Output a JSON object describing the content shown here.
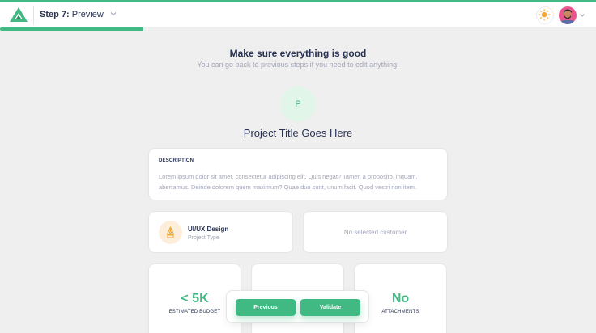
{
  "header": {
    "step_bold": "Step 7:",
    "step_light": "Preview",
    "progress_fraction": 0.24
  },
  "colors": {
    "accent": "#41b983",
    "text_dark": "#283252",
    "text_muted": "#a2a5b9",
    "background": "#efefef"
  },
  "icons": {
    "logo": "logo-triangle-icon",
    "step_menu": "chevron-down-icon",
    "theme": "sun-icon",
    "user": "user-avatar",
    "user_menu": "chevron-down-icon",
    "project_type": "pen-tool-icon"
  },
  "intro": {
    "title": "Make sure everything is good",
    "subtitle": "You can go back to previous steps if you need to edit anything."
  },
  "project": {
    "initial": "P",
    "title": "Project Title Goes Here"
  },
  "description": {
    "label": "DESCRIPTION",
    "text": "Lorem ipsum dolor sit amet, consectetur adipiscing elit. Quis negat? Tamen a proposito, inquam, aberramus. Deinde dolorem quem maximum? Quae duo sunt, unum facit. Quod vestri non item."
  },
  "project_type": {
    "name": "UI/UX Design",
    "label": "Project Type"
  },
  "customer": {
    "text": "No selected customer"
  },
  "stats": [
    {
      "value": "< 5K",
      "label": "Estimated Budget"
    },
    {
      "value": "",
      "label": ""
    },
    {
      "value": "No",
      "label": "Attachments"
    }
  ],
  "actions": {
    "previous": "Previous",
    "validate": "Validate"
  }
}
